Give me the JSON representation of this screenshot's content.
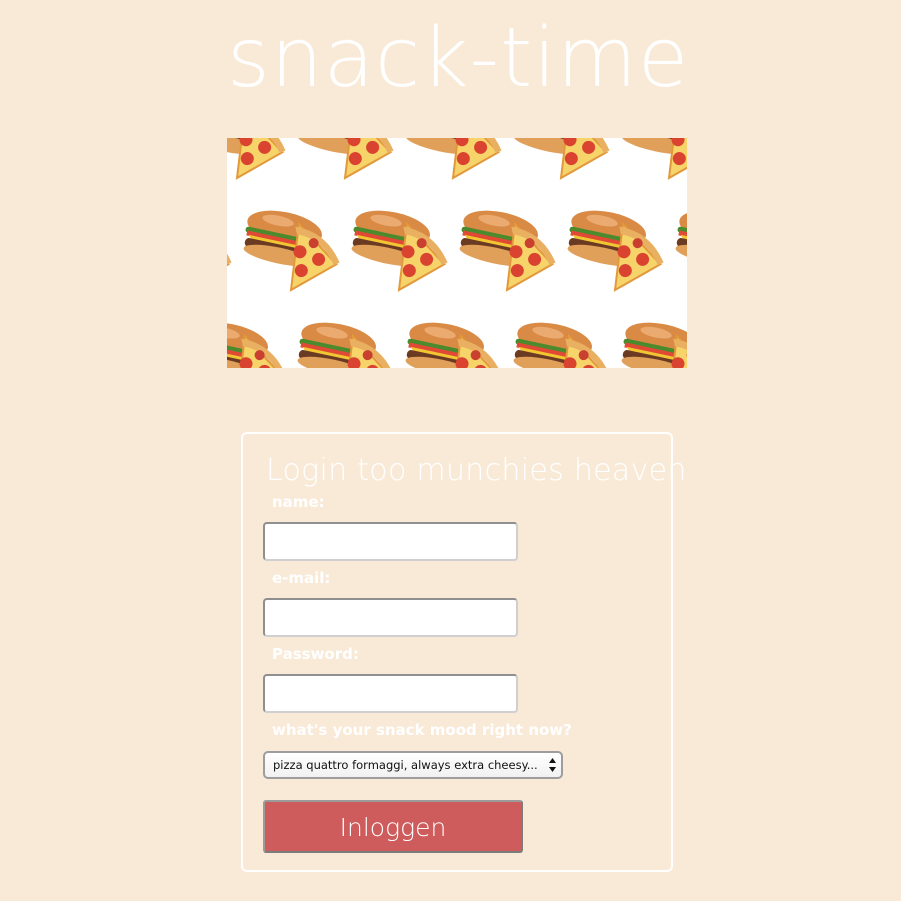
{
  "site": {
    "title": "snack-time"
  },
  "banner": {
    "pattern": [
      "pizza-slice-icon",
      "hamburger-icon"
    ],
    "colors": {
      "background": "#ffffff",
      "pizza_crust": "#e9b062",
      "pizza_sauce": "#e34a2b",
      "pepperoni": "#c9402f",
      "bun": "#d98a45",
      "cheese": "#f2c532",
      "lettuce": "#4c8a2e",
      "patty": "#6b3a22"
    }
  },
  "login": {
    "heading": "Login too munchies heaven",
    "name_label": "name:",
    "name_value": "",
    "email_label": "e-mail:",
    "email_value": "",
    "password_label": "Password:",
    "password_value": "",
    "mood_label": "what's your snack mood right now?",
    "mood_selected": "pizza quattro formaggi, always extra cheesy...",
    "submit_label": "Inloggen"
  },
  "colors": {
    "page_background": "#f9ead8",
    "text": "#ffffff",
    "button": "#cf5c5c"
  }
}
